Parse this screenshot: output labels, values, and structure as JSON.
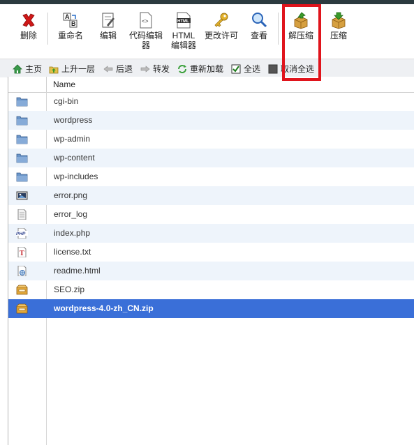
{
  "toolbar": {
    "delete": "删除",
    "rename": "重命名",
    "edit": "编辑",
    "code_editor_1": "代码编辑",
    "code_editor_2": "器",
    "html_editor_1": "HTML",
    "html_editor_2": "编辑器",
    "permissions": "更改许可",
    "view": "查看",
    "extract": "解压缩",
    "compress": "压缩"
  },
  "nav": {
    "home": "主页",
    "up": "上升一层",
    "back": "后退",
    "forward": "转发",
    "reload": "重新加载",
    "select_all": "全选",
    "deselect_all": "取消全选"
  },
  "table": {
    "header_name": "Name",
    "files": [
      {
        "name": "cgi-bin",
        "icon": "folder-icon"
      },
      {
        "name": "wordpress",
        "icon": "folder-icon"
      },
      {
        "name": "wp-admin",
        "icon": "folder-icon"
      },
      {
        "name": "wp-content",
        "icon": "folder-icon"
      },
      {
        "name": "wp-includes",
        "icon": "folder-icon"
      },
      {
        "name": "error.png",
        "icon": "image-file-icon"
      },
      {
        "name": "error_log",
        "icon": "text-file-icon"
      },
      {
        "name": "index.php",
        "icon": "php-file-icon"
      },
      {
        "name": "license.txt",
        "icon": "txt-file-icon"
      },
      {
        "name": "readme.html",
        "icon": "html-file-icon"
      },
      {
        "name": "SEO.zip",
        "icon": "archive-icon"
      },
      {
        "name": "wordpress-4.0-zh_CN.zip",
        "icon": "archive-icon",
        "selected": true
      }
    ]
  },
  "colors": {
    "selected_row": "#3a6fd8",
    "alt_row": "#eef4fb",
    "highlight_box": "#e0141c"
  }
}
